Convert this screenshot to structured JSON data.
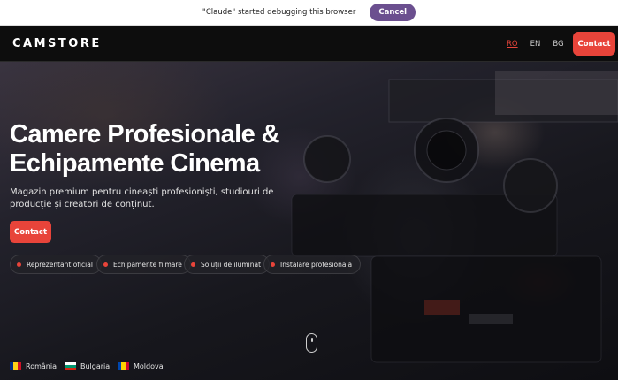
{
  "debug_bar": {
    "message": "\"Claude\" started debugging this browser",
    "cancel_label": "Cancel"
  },
  "header": {
    "logo": "CAMSTORE",
    "languages": [
      {
        "code": "RO",
        "active": true
      },
      {
        "code": "EN",
        "active": false
      },
      {
        "code": "BG",
        "active": false
      }
    ],
    "contact_label": "Contact"
  },
  "hero": {
    "title_line1": "Camere Profesionale &",
    "title_line2": "Echipamente Cinema",
    "subtitle": "Magazin premium pentru cineaști profesioniști, studiouri de producție și creatori de conținut.",
    "contact_label": "Contact",
    "features": [
      "Reprezentant oficial",
      "Echipamente filmare",
      "Soluții de iluminat",
      "Instalare profesională"
    ],
    "countries": [
      {
        "name": "România",
        "flag": [
          "#002b7f",
          "#fcd116",
          "#ce1126"
        ]
      },
      {
        "name": "Bulgaria",
        "flag": [
          "#ffffff",
          "#00966e",
          "#d62612"
        ]
      },
      {
        "name": "Moldova",
        "flag": [
          "#0046ae",
          "#ffd200",
          "#cc092f"
        ]
      }
    ]
  },
  "colors": {
    "accent": "#e8443a",
    "debug_button": "#6b4f8f"
  }
}
